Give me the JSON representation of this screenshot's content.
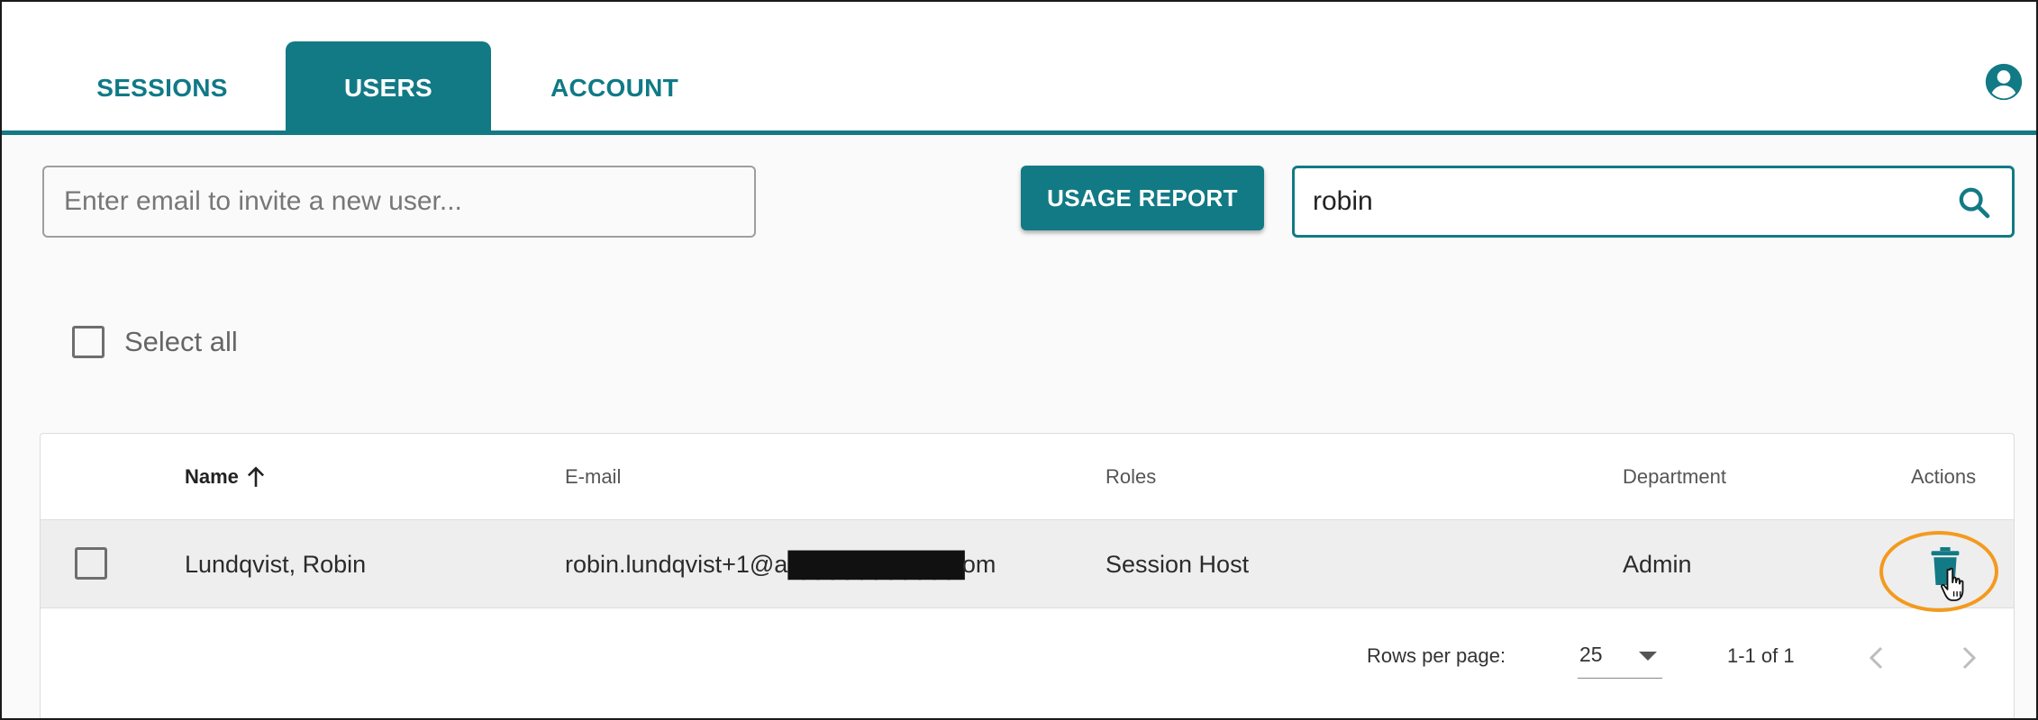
{
  "nav": {
    "tabs": [
      {
        "label": "SESSIONS",
        "active": false
      },
      {
        "label": "USERS",
        "active": true
      },
      {
        "label": "ACCOUNT",
        "active": false
      }
    ],
    "account_icon": "account-circle-icon"
  },
  "toolbar": {
    "invite_placeholder": "Enter email to invite a new user...",
    "usage_report_label": "USAGE REPORT",
    "search_value": "robin",
    "search_icon": "search-icon"
  },
  "select_all": {
    "label": "Select all",
    "checked": false
  },
  "table": {
    "columns": {
      "name": "Name",
      "email": "E-mail",
      "roles": "Roles",
      "department": "Department",
      "actions": "Actions"
    },
    "sort": {
      "column": "name",
      "direction": "asc"
    },
    "rows": [
      {
        "name": "Lundqvist, Robin",
        "email_prefix": "robin.lundqvist+1@a",
        "email_redacted": "████████████",
        "email_suffix": "om",
        "roles": "Session Host",
        "department": "Admin",
        "checked": false,
        "action_icon": "trash-icon"
      }
    ]
  },
  "pagination": {
    "rows_per_page_label": "Rows per page:",
    "rows_per_page": "25",
    "range": "1-1 of 1"
  },
  "colors": {
    "accent": "#127a85",
    "highlight": "#f39a1e",
    "row_bg": "#eeeeee"
  }
}
